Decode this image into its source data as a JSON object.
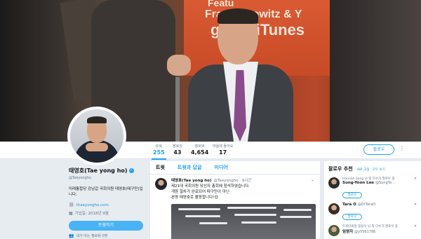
{
  "banner": {
    "screen_lines": [
      "Featu",
      "Fran Lebowitz & Y",
      "ge on iTunes"
    ]
  },
  "profile": {
    "name": "태영호(Tae yong ho)",
    "handle": "@Taeyongho",
    "bio": "미래통합당 강남갑 국회의원 태영호(태구민)입니다.",
    "website": "thaeyongho.com",
    "joined": "가입일: 2018년 9월",
    "tweet_to_label": "트윗하기",
    "followers_you_know": "내가 아는 팔로워 0명"
  },
  "nav": {
    "stats": [
      {
        "label": "트윗",
        "value": "255"
      },
      {
        "label": "팔로잉",
        "value": "43"
      },
      {
        "label": "팔로워",
        "value": "4,654"
      },
      {
        "label": "마음에 들어요",
        "value": "17"
      }
    ],
    "follow_label": "팔로우",
    "more_icon": "⋮"
  },
  "timeline": {
    "tabs": [
      "트윗",
      "트윗과 답글",
      "미디어"
    ],
    "tweet": {
      "name": "태영호(Tae yong ho)",
      "handle": "@Taeyongho · 9시간",
      "lines": [
        "제21대 국회의원 당선자 총회에 참석하였습니다.",
        "개원 절차가 완료되어 태구민이 아닌",
        "본명 태영호로 활동합니다!😊"
      ],
      "more_icon": "⌄"
    }
  },
  "who_to_follow": {
    "title": "팔로우 추천",
    "links": "· 새로 고침 · 모두 보기",
    "suggestions": [
      {
        "context": "Hannah Song 님 외 다수가 팔로우 중",
        "name": "Sung-Yoon Lee",
        "handle": "@SungYo...",
        "button": "팔로우"
      },
      {
        "context": "",
        "name": "Tara O",
        "handle": "@DrTaraO",
        "button": "팔로우"
      },
      {
        "context": "트위터회원 정용우 님 외 다수가 팔로우 중",
        "name": "임영자",
        "handle": "@y5561786",
        "button": "팔로우"
      }
    ],
    "close_icon": "✕"
  },
  "colors": {
    "accent": "#1da1f2",
    "page_bg": "#e6ecf0"
  }
}
